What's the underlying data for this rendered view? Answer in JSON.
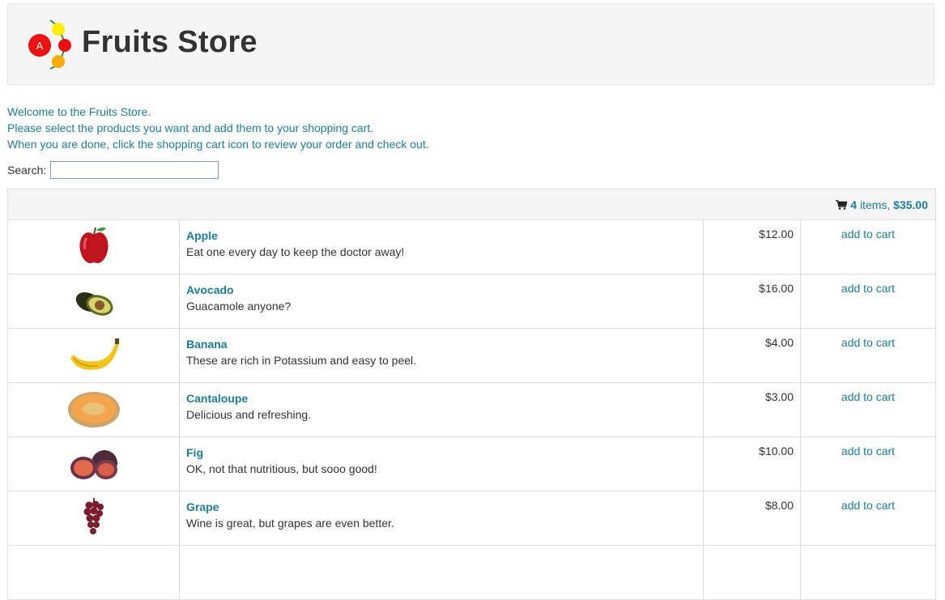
{
  "header": {
    "title": "Fruits Store",
    "logo_letter": "A"
  },
  "intro": {
    "line1": "Welcome to the Fruits Store.",
    "line2": "Please select the products you want and add them to your shopping cart.",
    "line3": "When you are done, click the shopping cart icon to review your order and check out."
  },
  "search": {
    "label": "Search:",
    "value": ""
  },
  "cart": {
    "count": "4",
    "items_label": "items,",
    "total": "$35.00"
  },
  "products": [
    {
      "name": "Apple",
      "description": "Eat one every day to keep the doctor away!",
      "price": "$12.00",
      "action": "add to cart",
      "icon": "apple-image"
    },
    {
      "name": "Avocado",
      "description": "Guacamole anyone?",
      "price": "$16.00",
      "action": "add to cart",
      "icon": "avocado-image"
    },
    {
      "name": "Banana",
      "description": "These are rich in Potassium and easy to peel.",
      "price": "$4.00",
      "action": "add to cart",
      "icon": "banana-image"
    },
    {
      "name": "Cantaloupe",
      "description": "Delicious and refreshing.",
      "price": "$3.00",
      "action": "add to cart",
      "icon": "cantaloupe-image"
    },
    {
      "name": "Fig",
      "description": "OK, not that nutritious, but sooo good!",
      "price": "$10.00",
      "action": "add to cart",
      "icon": "fig-image"
    },
    {
      "name": "Grape",
      "description": "Wine is great, but grapes are even better.",
      "price": "$8.00",
      "action": "add to cart",
      "icon": "grape-image"
    }
  ],
  "colors": {
    "accent": "#1a7f9c",
    "header_bg": "#f5f5f5",
    "border": "#dddddd"
  }
}
